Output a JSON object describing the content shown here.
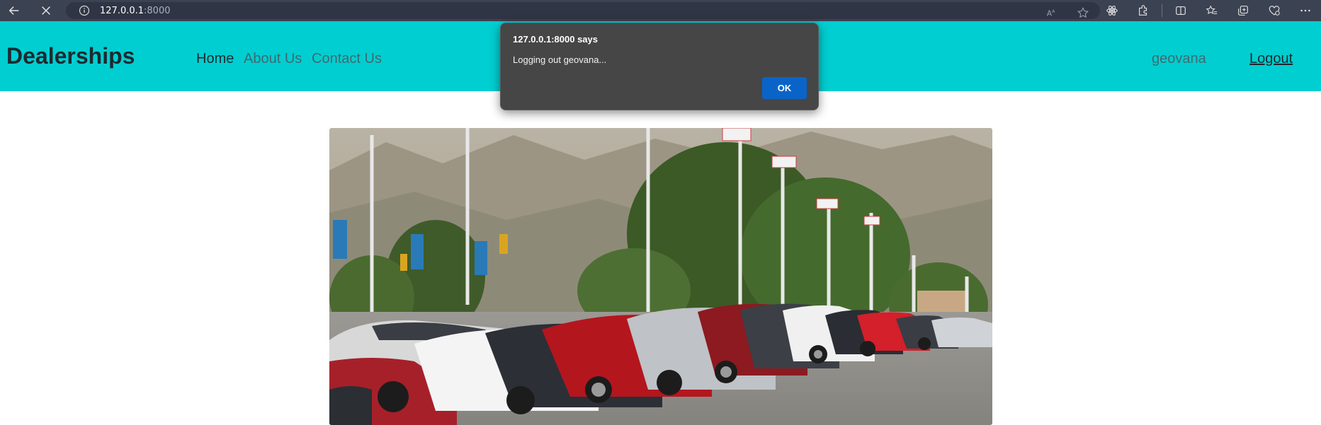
{
  "browser": {
    "url_host": "127.0.0.1",
    "url_port": ":8000",
    "icons": [
      "back-arrow-icon",
      "stop-loading-icon",
      "site-info-icon",
      "read-aloud-icon",
      "favorite-star-icon",
      "extension-icon",
      "puzzle-icon",
      "split-screen-icon",
      "favorites-icon",
      "collections-icon",
      "browser-essentials-icon",
      "more-icon"
    ]
  },
  "navbar": {
    "brand": "Dealerships",
    "links": [
      {
        "label": "Home"
      },
      {
        "label": "About Us"
      },
      {
        "label": "Contact Us"
      }
    ],
    "username": "geovana",
    "logout": "Logout",
    "background": "#00ced1"
  },
  "alert": {
    "title": "127.0.0.1:8000 says",
    "message": "Logging out geovana...",
    "ok_label": "OK",
    "ok_color": "#0a64c8"
  },
  "hero": {
    "subject": "car-dealership-lot-photo"
  }
}
